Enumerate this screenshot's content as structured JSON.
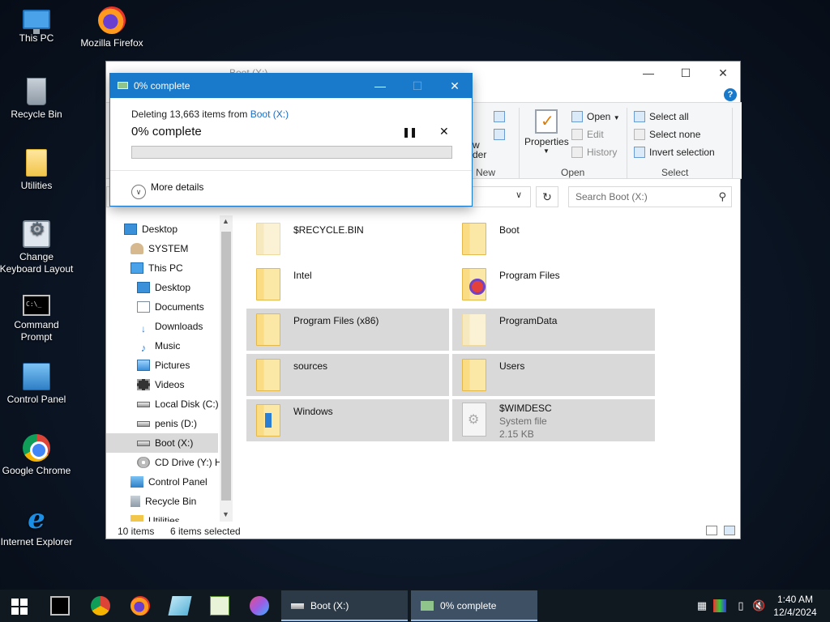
{
  "desktop": {
    "icons": [
      {
        "label": "This PC"
      },
      {
        "label": "Mozilla Firefox"
      },
      {
        "label": "Recycle Bin"
      },
      {
        "label": "Utilities"
      },
      {
        "label": "Change Keyboard Layout"
      },
      {
        "label": "Command Prompt"
      },
      {
        "label": "Control Panel"
      },
      {
        "label": "Google Chrome"
      },
      {
        "label": "Internet Explorer"
      }
    ]
  },
  "explorer": {
    "title": "Boot (X:)",
    "ribbon": {
      "new_label": "New",
      "new_folder_partial": "w\nder",
      "properties_label": "Properties",
      "open_group": "Open",
      "open_btn": "Open",
      "edit_btn": "Edit",
      "history_btn": "History",
      "select_group": "Select",
      "select_all": "Select all",
      "select_none": "Select none",
      "invert_selection": "Invert selection",
      "help_glyph": "?"
    },
    "search": {
      "placeholder": "Search Boot (X:)"
    },
    "nav": [
      {
        "label": "Desktop"
      },
      {
        "label": "SYSTEM"
      },
      {
        "label": "This PC"
      },
      {
        "label": "Desktop"
      },
      {
        "label": "Documents"
      },
      {
        "label": "Downloads"
      },
      {
        "label": "Music"
      },
      {
        "label": "Pictures"
      },
      {
        "label": "Videos"
      },
      {
        "label": "Local Disk (C:)"
      },
      {
        "label": "penis (D:)"
      },
      {
        "label": "Boot (X:)"
      },
      {
        "label": "CD Drive (Y:) H"
      },
      {
        "label": "Control Panel"
      },
      {
        "label": "Recycle Bin"
      },
      {
        "label": "Utilities"
      }
    ],
    "items": [
      {
        "name": "$RECYCLE.BIN"
      },
      {
        "name": "Boot"
      },
      {
        "name": "Intel"
      },
      {
        "name": "Program Files"
      },
      {
        "name": "Program Files (x86)"
      },
      {
        "name": "ProgramData"
      },
      {
        "name": "sources"
      },
      {
        "name": "Users"
      },
      {
        "name": "Windows"
      },
      {
        "name": "$WIMDESC",
        "type": "System file",
        "size": "2.15 KB"
      }
    ],
    "status": {
      "count": "10 items",
      "selected": "6 items selected"
    }
  },
  "dialog": {
    "title": "0% complete",
    "line_prefix": "Deleting 13,663 items from ",
    "line_link": "Boot (X:)",
    "percent_text": "0% complete",
    "progress": 0,
    "more_details": "More details",
    "accent": "#1979ca"
  },
  "taskbar": {
    "tasks": [
      {
        "label": "Boot (X:)"
      },
      {
        "label": "0% complete"
      }
    ],
    "time": "1:40 AM",
    "date": "12/4/2024"
  }
}
